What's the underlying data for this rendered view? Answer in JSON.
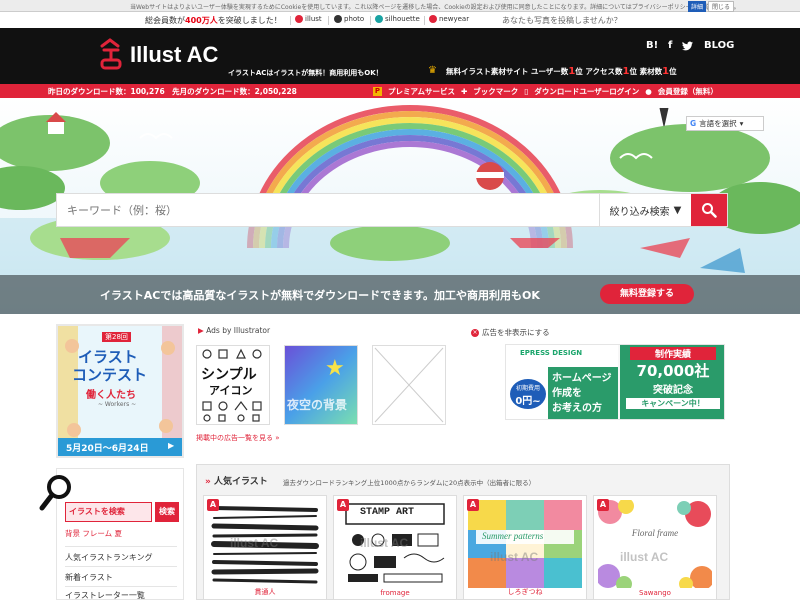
{
  "cookie": {
    "text": "当Webサイトはよりよいユーザー体験を実現するためにCookieを使用しています。これ以降ページを遷移した場合、Cookieの設定および使用に同意したことになります。詳細についてはプライバシーポリシーをご覧ください。",
    "detail_label": "詳細",
    "close_label": "閉じる"
  },
  "topbar": {
    "count_prefix": "総会員数が",
    "count_value": "400万人",
    "count_suffix": "を突破しました！",
    "links": [
      "illust",
      "photo",
      "silhouette",
      "newyear"
    ],
    "post_link": "あなたも写真を投稿しませんか？"
  },
  "header": {
    "logo_text": "Illust AC",
    "tagline": "イラストACはイラストが無料！商用利用もOK！",
    "social": [
      "B!",
      "f",
      "🐦",
      "BLOG"
    ],
    "ranking": {
      "part1": "無料イラスト素材サイト ユーザー数",
      "n1": "1",
      "u1": "位 アクセス数",
      "n2": "1",
      "u2": "位 素材数",
      "n3": "1",
      "u3": "位"
    }
  },
  "redbar": {
    "downloads": "昨日のダウンロード数：100,276　先月のダウンロード数：2,050,228",
    "menu": [
      "プレミアムサービス",
      "ブックマーク",
      "ダウンロードユーザーログイン",
      "会員登録（無料）"
    ]
  },
  "hero": {
    "search_placeholder": "キーワード（例：桜）",
    "filter_label": "絞り込み検索",
    "message": "イラストACでは高品質なイラストが無料でダウンロードできます。加工や商用利用もOK",
    "register_label": "無料登録する",
    "translate_label": "言語を選択"
  },
  "contest": {
    "edition": "第28回",
    "title1": "イラスト",
    "title2": "コンテスト",
    "theme": "働く人たち",
    "theme_en": "~ Workers ~",
    "period": "5月20日〜6月24日"
  },
  "ads": {
    "label": "Ads by Illustrator",
    "thumb1": [
      "シンプル",
      "アイコン"
    ],
    "thumb2": "夜空の背景",
    "more_link": "掲載中の広告一覧を見る »",
    "hide_label": "広告を非表示にする",
    "epress": {
      "brand": "EPRESS DESIGN",
      "cost_label": "初期費用",
      "cost_value": "0円~",
      "lines": [
        "ホームページ",
        "作成を",
        "お考えの方"
      ],
      "badge": "制作実績",
      "count": "70,000社",
      "count_sub": "突破記念",
      "campaign": "キャンペーン中！"
    }
  },
  "sidebar": {
    "search_value": "イラストを検索",
    "search_btn": "検索",
    "tags": "背景  フレーム  夏",
    "links": [
      "人気イラストランキング",
      "新着イラスト",
      "イラストレーター一覧"
    ]
  },
  "popular": {
    "title": "人気イラスト",
    "subtitle": "過去ダウンロードランキング上位1000点からランダムに20点表示中（出箱者に限る）",
    "cards": [
      {
        "author": "貫通人",
        "watermark": "illust AC"
      },
      {
        "author": "fromage",
        "watermark": "illust AC",
        "heading": "STAMP ART"
      },
      {
        "author": "しろぎつね",
        "watermark": "illust AC",
        "heading": "Summer patterns"
      },
      {
        "author": "Sawango",
        "watermark": "illust AC",
        "heading": "Floral frame"
      }
    ]
  },
  "colors": {
    "brand_red": "#e0243a",
    "header_bg": "#111111",
    "crown": "#f4b400"
  }
}
